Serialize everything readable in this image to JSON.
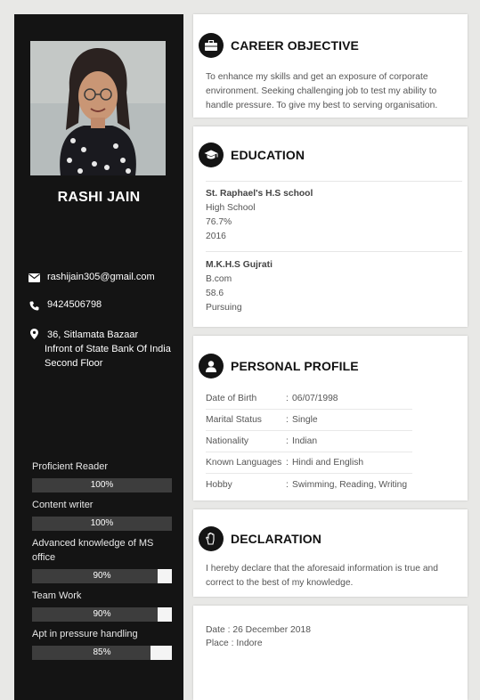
{
  "profile": {
    "name": "RASHI JAIN",
    "email": "rashijain305@gmail.com",
    "phone": "9424506798",
    "address": [
      "36, Sitlamata Bazaar",
      "Infront of State Bank Of India",
      "Second Floor"
    ]
  },
  "skills": [
    {
      "label": "Proficient Reader",
      "pct_text": "100%",
      "level": 1.0
    },
    {
      "label": "Content writer",
      "pct_text": "100%",
      "level": 1.0
    },
    {
      "label": "Advanced knowledge of MS office",
      "pct_text": "90%",
      "level": 0.9
    },
    {
      "label": "Team Work",
      "pct_text": "90%",
      "level": 0.9
    },
    {
      "label": "Apt in pressure handling",
      "pct_text": "85%",
      "level": 0.85
    }
  ],
  "career": {
    "title": "CAREER OBJECTIVE",
    "text": "To enhance my skills and get an exposure of corporate environment. Seeking challenging job to test my ability to handle pressure. To give my best to serving organisation."
  },
  "education": {
    "title": "EDUCATION",
    "entries": [
      {
        "school": "St. Raphael's H.S school",
        "degree": "High School",
        "score": "76.7%",
        "year": "2016"
      },
      {
        "school": "M.K.H.S Gujrati",
        "degree": "B.com",
        "score": "58.6",
        "year": "Pursuing"
      }
    ]
  },
  "personal": {
    "title": "PERSONAL PROFILE",
    "rows": [
      {
        "key": "Date of Birth",
        "value": "06/07/1998"
      },
      {
        "key": "Marital Status",
        "value": "Single"
      },
      {
        "key": "Nationality",
        "value": "Indian"
      },
      {
        "key": "Known Languages",
        "value": "Hindi and English"
      },
      {
        "key": "Hobby",
        "value": "Swimming, Reading, Writing"
      }
    ]
  },
  "declaration": {
    "title": "DECLARATION",
    "text": "I hereby declare that the aforesaid information is true and correct to the best of my knowledge."
  },
  "signoff": {
    "date_label": "Date :",
    "date": "26 December 2018",
    "place_label": "Place :",
    "place": "Indore"
  },
  "icons": {
    "email": "envelope-icon",
    "phone": "phone-icon",
    "address": "map-marker-icon",
    "career": "briefcase-icon",
    "education": "graduation-cap-icon",
    "personal": "user-icon",
    "declaration": "hand-icon"
  }
}
